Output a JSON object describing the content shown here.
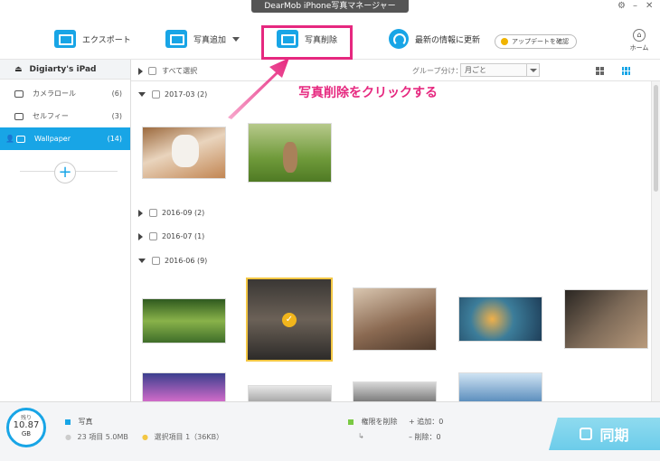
{
  "window": {
    "title": "DearMob iPhone写真マネージャー"
  },
  "toolbar": {
    "export": "エクスポート",
    "add_photo": "写真追加",
    "delete_photo": "写真削除",
    "update_info": "最新の情報に更新",
    "check_update": "アップデートを確認",
    "home": "ホーム"
  },
  "sidebar": {
    "device": "Digiarty's iPad",
    "items": [
      {
        "label": "カメラロール",
        "count": "(6)"
      },
      {
        "label": "セルフィー",
        "count": "(3)"
      },
      {
        "label": "Wallpaper",
        "count": "(14)"
      }
    ]
  },
  "main": {
    "select_all": "すべて選択",
    "group_by_label": "グループ分け：",
    "group_by_value": "月ごと",
    "groups": [
      {
        "label": "2017-03 (2)"
      },
      {
        "label": "2016-09 (2)"
      },
      {
        "label": "2016-07 (1)"
      },
      {
        "label": "2016-06 (9)"
      }
    ]
  },
  "annotation": "写真削除をクリックする",
  "footer": {
    "storage_label": "残り",
    "storage_value": "10.87",
    "storage_unit": "GB",
    "photos_label": "写真",
    "photos_summary": "23 項目 5.0MB",
    "selected_summary": "選択項目 1（36KB）",
    "permission_delete": "権限を削除",
    "added": "追加：0",
    "deleted": "削除：0",
    "sync": "同期"
  },
  "colors": {
    "accent": "#18a5e6",
    "highlight": "#e6287f",
    "selected": "#f3c744"
  }
}
